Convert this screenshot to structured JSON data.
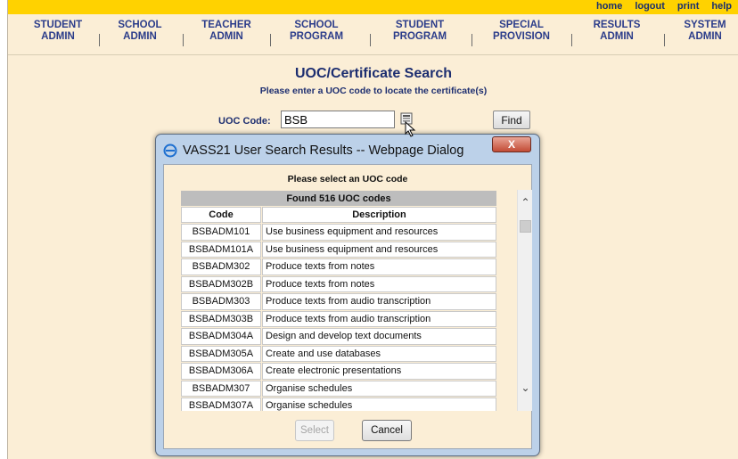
{
  "toplinks": [
    "home",
    "logout",
    "print",
    "help"
  ],
  "nav": [
    {
      "l1": "STUDENT",
      "l2": "ADMIN"
    },
    {
      "l1": "SCHOOL",
      "l2": "ADMIN"
    },
    {
      "l1": "TEACHER",
      "l2": "ADMIN"
    },
    {
      "l1": "SCHOOL",
      "l2": "PROGRAM"
    },
    {
      "l1": "STUDENT",
      "l2": "PROGRAM"
    },
    {
      "l1": "SPECIAL",
      "l2": "PROVISION"
    },
    {
      "l1": "RESULTS",
      "l2": "ADMIN"
    },
    {
      "l1": "SYSTEM",
      "l2": "ADMIN"
    }
  ],
  "page": {
    "title": "UOC/Certificate Search",
    "subtitle": "Please enter a UOC code to locate the certificate(s)",
    "uoc_label": "UOC Code:",
    "uoc_value": "BSB",
    "find_label": "Find"
  },
  "dialog": {
    "title": "VASS21 User Search Results -- Webpage Dialog",
    "close_label": "X",
    "prompt": "Please select an UOC code",
    "found": "Found 516 UOC codes",
    "headers": {
      "code": "Code",
      "description": "Description"
    },
    "rows": [
      {
        "code": "BSBADM101",
        "description": "Use business equipment and resources"
      },
      {
        "code": "BSBADM101A",
        "description": "Use business equipment and resources"
      },
      {
        "code": "BSBADM302",
        "description": "Produce texts from notes"
      },
      {
        "code": "BSBADM302B",
        "description": "Produce texts from notes"
      },
      {
        "code": "BSBADM303",
        "description": "Produce texts from audio transcription"
      },
      {
        "code": "BSBADM303B",
        "description": "Produce texts from audio transcription"
      },
      {
        "code": "BSBADM304A",
        "description": "Design and develop text documents"
      },
      {
        "code": "BSBADM305A",
        "description": "Create and use databases"
      },
      {
        "code": "BSBADM306A",
        "description": "Create electronic presentations"
      },
      {
        "code": "BSBADM307",
        "description": "Organise schedules"
      },
      {
        "code": "BSBADM307A",
        "description": "Organise schedules"
      }
    ],
    "select_label": "Select",
    "cancel_label": "Cancel"
  },
  "colors": {
    "topbar": "#ffd200",
    "page_bg": "#fbeed6",
    "nav_text": "#2b3c8a",
    "title_text": "#1d2e70",
    "dialog_frame": "#bcd1e9",
    "close_button": "#c24b35"
  },
  "icons": {
    "dialog": "ie-icon",
    "picker": "lookup-icon",
    "scroll_up": "chevron-up-icon",
    "scroll_down": "chevron-down-icon"
  }
}
